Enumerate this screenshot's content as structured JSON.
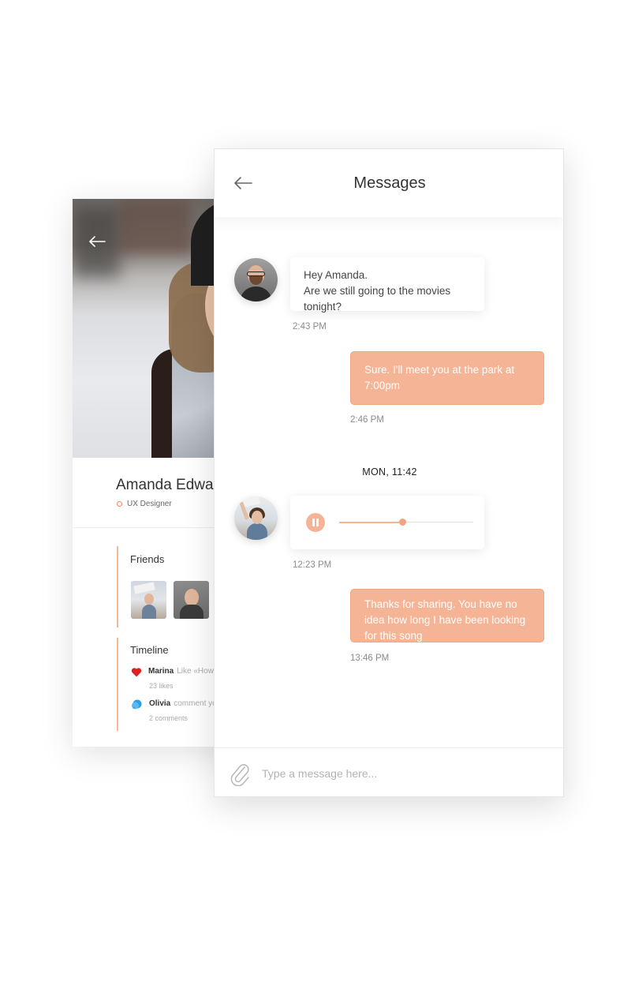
{
  "profile": {
    "name": "Amanda Edwards",
    "role": "UX Designer",
    "friends_title": "Friends",
    "timeline_title": "Timeline",
    "timeline": [
      {
        "user": "Marina",
        "action": "Like «How",
        "meta": "23 likes",
        "icon": "heart-icon",
        "icon_color": "#e02020"
      },
      {
        "user": "Olivia",
        "action": "comment yo",
        "meta": "2 comments",
        "icon": "chat-bubble-icon",
        "icon_color": "#2e9fe6"
      }
    ]
  },
  "header": {
    "title": "Messages"
  },
  "conversation": {
    "messages": [
      {
        "direction": "in",
        "sender_avatar": "man",
        "lines": [
          "Hey Amanda.",
          "Are we still going to the movies tonight?"
        ],
        "time": "2:43 PM"
      },
      {
        "direction": "out",
        "text": "Sure. I'll meet you at the park at 7:00pm",
        "time": "2:46 PM"
      },
      {
        "direction": "in",
        "sender_avatar": "woman",
        "type": "voice",
        "progress": 0.47,
        "time": "12:23 PM"
      },
      {
        "direction": "out",
        "text": "Thanks for sharing. You have no idea how long I have been looking for this song",
        "time": "13:46 PM"
      }
    ],
    "day_separator": "MON, 11:42"
  },
  "composer": {
    "placeholder": "Type a message here..."
  },
  "colors": {
    "accent": "#f5b496",
    "accent_border": "#efa784",
    "text": "#333333",
    "muted": "#8c8c8c"
  }
}
